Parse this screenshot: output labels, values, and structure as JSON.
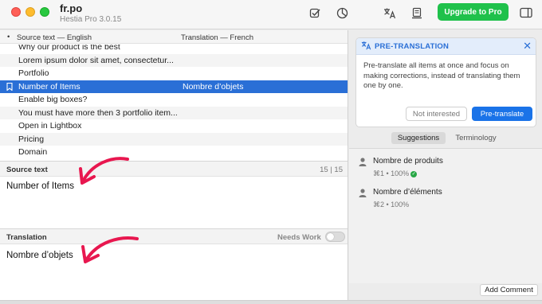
{
  "window": {
    "title": "fr.po",
    "subtitle": "Hestia Pro 3.0.15"
  },
  "toolbar": {
    "upgrade_label": "Upgrade to Pro",
    "icons": [
      "checkbox-icon",
      "statistics-icon",
      "translate-icon",
      "document-icon",
      "sidebar-icon"
    ]
  },
  "list": {
    "bullet": "•",
    "col_source": "Source text — English",
    "col_translation": "Translation — French",
    "rows": [
      {
        "source": "Why our product is the best",
        "translation": ""
      },
      {
        "source": "Lorem ipsum dolor sit amet, consectetur...",
        "translation": ""
      },
      {
        "source": "Portfolio",
        "translation": ""
      },
      {
        "source": "Number of Items",
        "translation": "Nombre d’objets",
        "selected": true
      },
      {
        "source": "Enable big boxes?",
        "translation": ""
      },
      {
        "source": "You must have more then 3 portfolio item...",
        "translation": ""
      },
      {
        "source": "Open in Lightbox",
        "translation": ""
      },
      {
        "source": "Pricing",
        "translation": ""
      },
      {
        "source": "Domain",
        "translation": ""
      }
    ]
  },
  "source_panel": {
    "label": "Source text",
    "count": "15 | 15",
    "text": "Number of Items"
  },
  "translation_panel": {
    "label": "Translation",
    "needs_work_label": "Needs Work",
    "text": "Nombre d’objets"
  },
  "pretranslation": {
    "title": "PRE-TRANSLATION",
    "close": "✕",
    "description": "Pre-translate all items at once and focus on making corrections, instead of translating them one by one.",
    "not_interested": "Not interested",
    "pretranslate": "Pre-translate"
  },
  "tabs": {
    "suggestions": "Suggestions",
    "terminology": "Terminology"
  },
  "suggestions": [
    {
      "text": "Nombre de produits",
      "meta": "⌘1 • 100%",
      "verified": true
    },
    {
      "text": "Nombre d’éléments",
      "meta": "⌘2 • 100%",
      "verified": false
    }
  ],
  "add_comment": "Add Comment",
  "colors": {
    "selection": "#2a6fd6",
    "upgrade": "#1fc14b",
    "accent_blue": "#1a73e8",
    "arrow": "#e8174f"
  }
}
